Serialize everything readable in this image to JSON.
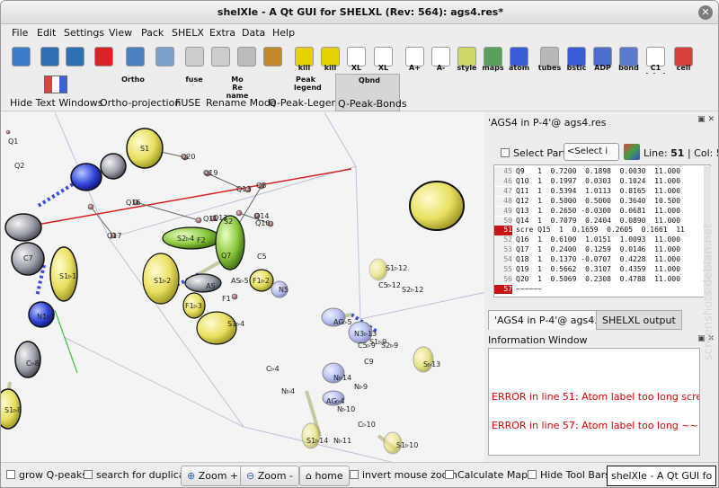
{
  "window": {
    "title": "shelXle - A Qt GUI for SHELXL (Rev: 564): ags4.res*"
  },
  "menu": [
    "File",
    "Edit",
    "Settings",
    "View",
    "Pack",
    "SHELX",
    "Extra",
    "Data",
    "Help"
  ],
  "toolbar1": [
    {
      "name": "new-icon",
      "label": "",
      "color": "#3b7dc8"
    },
    {
      "name": "save-icon",
      "label": "",
      "color": "#2f6fb3"
    },
    {
      "name": "save-as-icon",
      "label": "",
      "color": "#2f6fb3"
    },
    {
      "name": "stop-icon",
      "label": "",
      "color": "#d82424"
    },
    {
      "name": "undo-icon",
      "label": "",
      "color": "#4a7fc0"
    },
    {
      "name": "redo-icon",
      "label": "",
      "color": "#7aa0cc"
    },
    {
      "name": "copy-icon",
      "label": "",
      "color": "#cccccc"
    },
    {
      "name": "paste-icon",
      "label": "",
      "color": "#cccccc"
    },
    {
      "name": "find-icon",
      "label": "",
      "color": "#bbbbbb"
    },
    {
      "name": "zoom-find-icon",
      "label": "",
      "color": "#c08a2a"
    },
    {
      "name": "kill-icon",
      "label": "kill",
      "color": "#e6d200"
    },
    {
      "name": "kill-all-icon",
      "label": "kill",
      "color": "#e6d200"
    },
    {
      "name": "xl-refine-icon",
      "label": "XL",
      "color": "#ffffff"
    },
    {
      "name": "xl-refine-red-icon",
      "label": "XL",
      "color": "#ffffff"
    },
    {
      "name": "a-plus-icon",
      "label": "A+",
      "color": "#ffffff"
    },
    {
      "name": "a-minus-icon",
      "label": "A-",
      "color": "#ffffff"
    },
    {
      "name": "style-icon",
      "label": "style",
      "color": "#cfd96a"
    },
    {
      "name": "maps-icon",
      "label": "maps",
      "color": "#5aa05a"
    },
    {
      "name": "atom-icon",
      "label": "atom",
      "color": "#3b5bd8"
    },
    {
      "name": "tubes-icon",
      "label": "tubes",
      "color": "#b8b8b8"
    },
    {
      "name": "bstic-icon",
      "label": "bstic",
      "color": "#3b5bd8"
    },
    {
      "name": "adp-icon",
      "label": "ADP",
      "color": "#4c6fd0"
    },
    {
      "name": "bond-icon",
      "label": "bond",
      "color": "#5a7ad0"
    },
    {
      "name": "label-icon",
      "label": "C1 label",
      "color": "#ffffff"
    },
    {
      "name": "cell-icon",
      "label": "cell",
      "color": "#d84040"
    }
  ],
  "toolbar2": [
    {
      "name": "hide-text-windows-button",
      "label": "Hide Text Windows"
    },
    {
      "name": "ortho-projection-button",
      "label": "Ortho-projection",
      "icon_text": "Ortho"
    },
    {
      "name": "fuse-button",
      "label": "FUSE",
      "icon_text": "fuse"
    },
    {
      "name": "rename-mode-button",
      "label": "Rename Mode",
      "icon_text": "Mo Re name"
    },
    {
      "name": "q-peak-legend-button",
      "label": "Q-Peak-Legend",
      "icon_text": "Peak legend"
    },
    {
      "name": "q-peak-bonds-button",
      "label": "Q-Peak-Bonds",
      "icon_text": "Qbnd"
    }
  ],
  "structure": {
    "labels": [
      "S1",
      "Q20",
      "Q19",
      "Q13",
      "Q8",
      "Q16",
      "Q17",
      "Q14",
      "Q11",
      "Q12",
      "Q10",
      "S2",
      "S2▹4",
      "F2",
      "Q7",
      "C5",
      "N5",
      "S1▹2",
      "F1▹2",
      "AS",
      "F1▹3",
      "F1",
      "AS▹5",
      "S1▹4",
      "N1▹1",
      "S1▹1",
      "C7",
      "Q1",
      "Q2",
      "S1▹12",
      "C5▹12",
      "S2▹12",
      "AG▹5",
      "N3▹13",
      "C5▹9",
      "S1▹9",
      "S2▹9",
      "C9",
      "S▹13",
      "C▹4",
      "N▹4",
      "N▹14",
      "N▹9",
      "AG▹4",
      "N▹10",
      "C▹10",
      "S1▹14",
      "N▹11",
      "S1▹10",
      "S1▹8",
      "C▹8"
    ]
  },
  "right_panel": {
    "dock_title": "'AGS4 in P-4'@ ags4.res",
    "select_part_label": "Select Part",
    "select_placeholder": "<Select i",
    "line_label": "Line:",
    "line_value": "51",
    "col_label": "Col:",
    "col_value": "5",
    "code_lines": [
      {
        "num": "45",
        "text": "Q9   1  0.7200  0.1898  0.0030  11.000"
      },
      {
        "num": "46",
        "text": "Q10  1  0.1997  0.0303  0.1024  11.000"
      },
      {
        "num": "47",
        "text": "Q11  1  0.5394  1.0113  0.8165  11.000"
      },
      {
        "num": "48",
        "text": "Q12  1  0.5000  0.5000  0.3640  10.500"
      },
      {
        "num": "49",
        "text": "Q13  1  0.2650 -0.0300  0.0681  11.000"
      },
      {
        "num": "50",
        "text": "Q14  1  0.7079  0.2404  0.0890  11.000"
      },
      {
        "num": "51",
        "text": "scre Q15  1  0.1659  0.2605  0.1661  11"
      },
      {
        "num": "52",
        "text": "Q16  1  0.6100  1.0151  1.0093  11.000"
      },
      {
        "num": "53",
        "text": "Q17  1  0.2400  0.1259  0.0146  11.000"
      },
      {
        "num": "54",
        "text": "Q18  1  0.1370 -0.0707  0.4228  11.000"
      },
      {
        "num": "55",
        "text": "Q19  1  0.5662  0.3107  0.4359  11.000"
      },
      {
        "num": "56",
        "text": "Q20  1  0.5069  0.2308  0.4788  11.000"
      },
      {
        "num": "57",
        "text": "~~~~~~"
      }
    ],
    "tabs": [
      "'AGS4 in P-4'@ ags4.res",
      "SHELXL output"
    ],
    "info_title": "Information Window",
    "errors": [
      "ERROR in line 51: Atom label too long scre",
      "ERROR in line 57: Atom label too long ~~~~"
    ]
  },
  "status": {
    "grow_qpeaks": "grow Q-peaks",
    "search_duplicate": "search for duplicate",
    "zoom_in": "Zoom +",
    "zoom_out": "Zoom -",
    "home": "home",
    "invert_zoom": "invert mouse zoom",
    "calc_maps": "Calculate Maps",
    "hide_toolbars": "Hide Tool Bars",
    "status_line": "shelXle - A Qt GUI fo"
  },
  "watermark": "screenshots.debian.net"
}
